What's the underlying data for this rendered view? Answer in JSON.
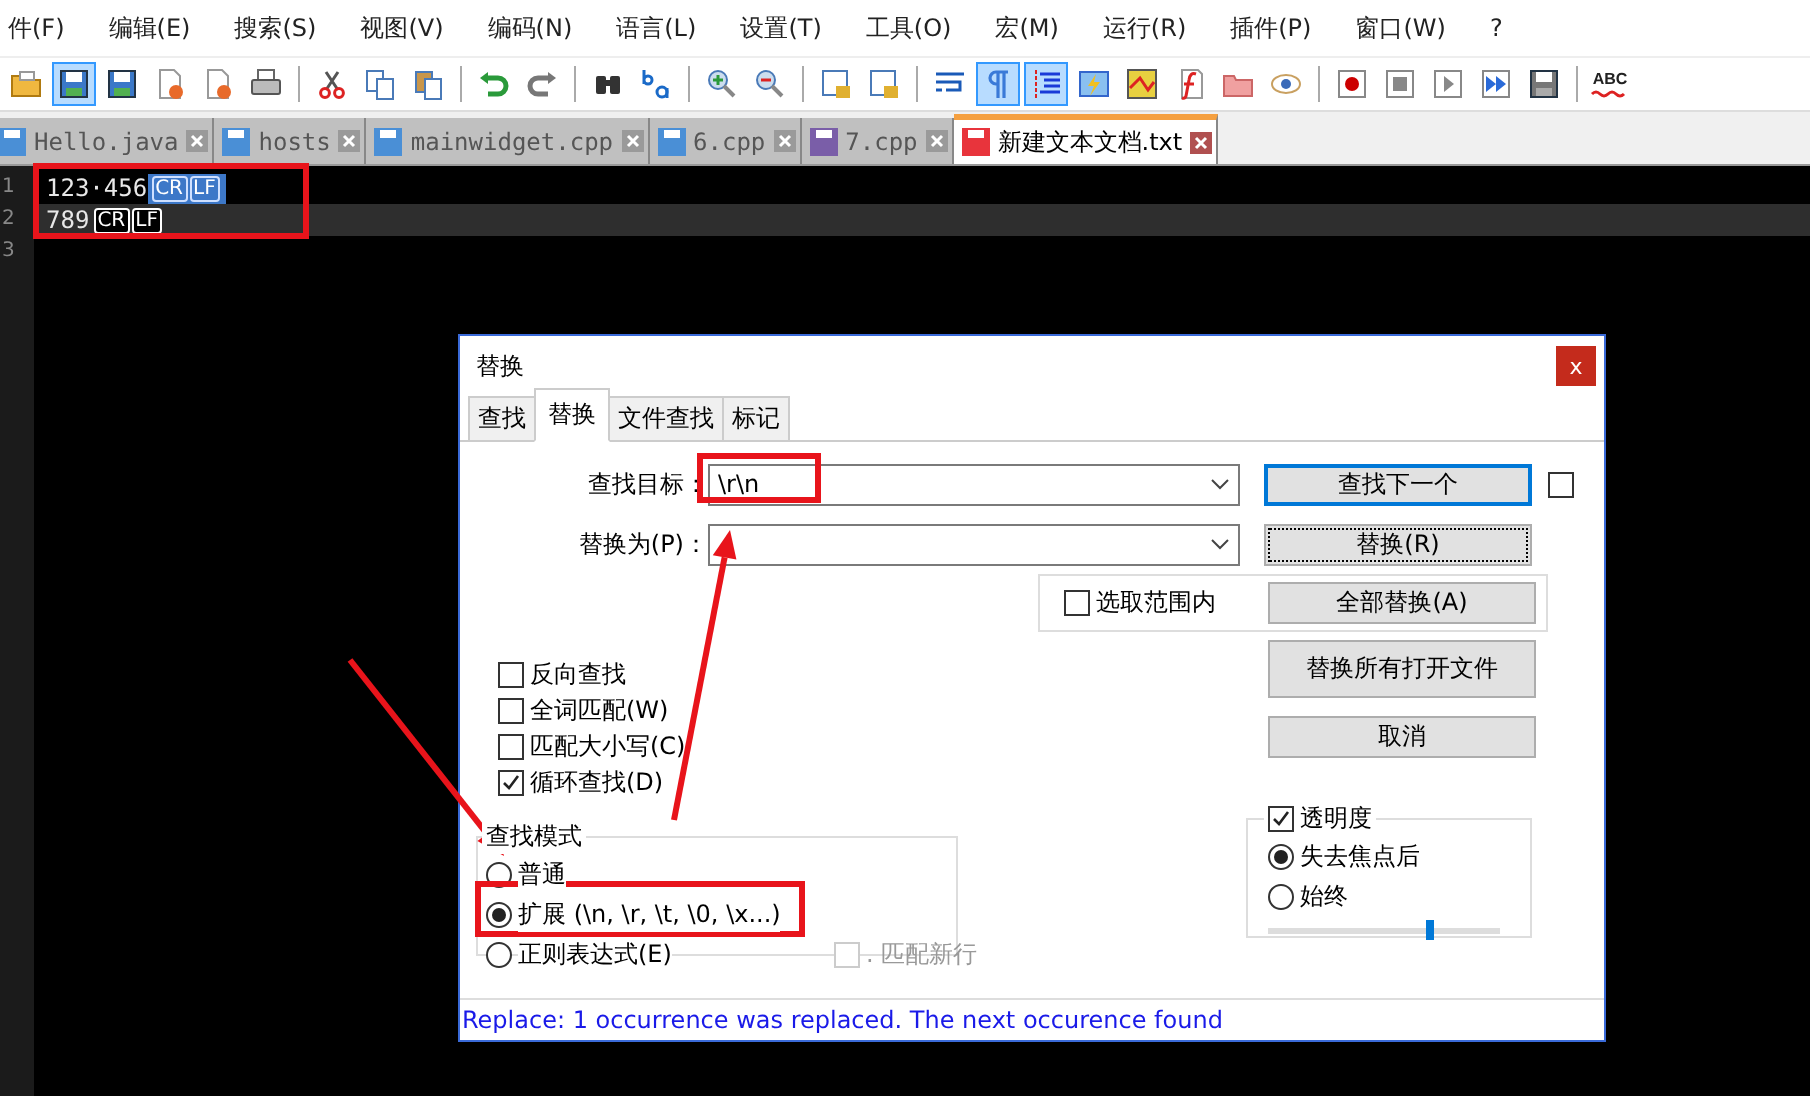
{
  "menu": [
    {
      "label": "件(F)"
    },
    {
      "label": "编辑(E)"
    },
    {
      "label": "搜索(S)"
    },
    {
      "label": "视图(V)"
    },
    {
      "label": "编码(N)"
    },
    {
      "label": "语言(L)"
    },
    {
      "label": "设置(T)"
    },
    {
      "label": "工具(O)"
    },
    {
      "label": "宏(M)"
    },
    {
      "label": "运行(R)"
    },
    {
      "label": "插件(P)"
    },
    {
      "label": "窗口(W)"
    },
    {
      "label": "?"
    }
  ],
  "toolbar": [
    {
      "pressed": false
    },
    {
      "pressed": true
    },
    {
      "pressed": false
    },
    {
      "pressed": false
    },
    {
      "pressed": false
    },
    {
      "pressed": false
    },
    {
      "pressed": false
    },
    {
      "pressed": false
    },
    {
      "pressed": false
    },
    {
      "pressed": false
    },
    {
      "pressed": false
    },
    {
      "pressed": false
    },
    {
      "pressed": false
    },
    {
      "pressed": false
    },
    {
      "pressed": false
    },
    {
      "pressed": false
    },
    {
      "pressed": false
    },
    {
      "pressed": false
    },
    {
      "pressed": true
    },
    {
      "pressed": true
    },
    {
      "pressed": false
    },
    {
      "pressed": false
    },
    {
      "pressed": false
    },
    {
      "pressed": false
    },
    {
      "pressed": false
    },
    {
      "pressed": false
    },
    {
      "pressed": false
    },
    {
      "pressed": false
    },
    {
      "pressed": false
    },
    {
      "pressed": false
    },
    {
      "pressed": false,
      "label": "ABC"
    }
  ],
  "file_tabs": [
    {
      "label": "Hello.java",
      "selected": false,
      "color": "#4a8fd6"
    },
    {
      "label": "hosts",
      "selected": false,
      "color": "#4a8fd6"
    },
    {
      "label": "mainwidget.cpp",
      "selected": false,
      "color": "#4a8fd6"
    },
    {
      "label": "6.cpp",
      "selected": false,
      "color": "#4a8fd6"
    },
    {
      "label": "7.cpp",
      "selected": false,
      "color": "#7a5ea8"
    },
    {
      "label": "新建文本文档.txt",
      "selected": true,
      "color": "#e8343c"
    }
  ],
  "editor": {
    "lines": [
      {
        "number": "1",
        "text": "123·456",
        "eol": [
          "CR",
          "LF"
        ],
        "eol_selected": true,
        "current": false
      },
      {
        "number": "2",
        "text": "789",
        "eol": [
          "CR",
          "LF"
        ],
        "eol_selected": false,
        "current": true
      },
      {
        "number": "3",
        "current": false
      }
    ]
  },
  "dialog": {
    "title": "替换",
    "close": "x",
    "tabs": [
      {
        "label": "查找",
        "selected": false
      },
      {
        "label": "替换",
        "selected": true
      },
      {
        "label": "文件查找",
        "selected": false
      },
      {
        "label": "标记",
        "selected": false
      }
    ],
    "find_label": "查找目标：",
    "find_value": "\\r\\n",
    "replace_label": "替换为(P)：",
    "find_next": "查找下一个",
    "find_next_extra": {
      "checked": false
    },
    "replace": "替换(R)",
    "in_selection": {
      "label": "选取范围内",
      "checked": false
    },
    "replace_all": "全部替换(A)",
    "replace_all_open": "替换所有打开文件",
    "cancel": "取消",
    "options": [
      {
        "label": "反向查找",
        "checked": false
      },
      {
        "label": "全词匹配(W)",
        "checked": false
      },
      {
        "label": "匹配大小写(C)",
        "checked": false
      },
      {
        "label": "循环查找(D)",
        "checked": true
      }
    ],
    "search_mode": {
      "title": "查找模式",
      "options": [
        {
          "label": "普通",
          "selected": false
        },
        {
          "label": "扩展 (\\n, \\r, \\t, \\0, \\x...)",
          "selected": true
        },
        {
          "label": "正则表达式(E)",
          "selected": false
        }
      ],
      "match_newline": {
        "label": ". 匹配新行",
        "checked": false,
        "disabled": true
      }
    },
    "transparency": {
      "label": "透明度",
      "checked": true,
      "options": [
        {
          "label": "失去焦点后",
          "selected": true
        },
        {
          "label": "始终",
          "selected": false
        }
      ],
      "level": 0.7
    },
    "status": "Replace: 1 occurrence was replaced. The next occurence found"
  }
}
